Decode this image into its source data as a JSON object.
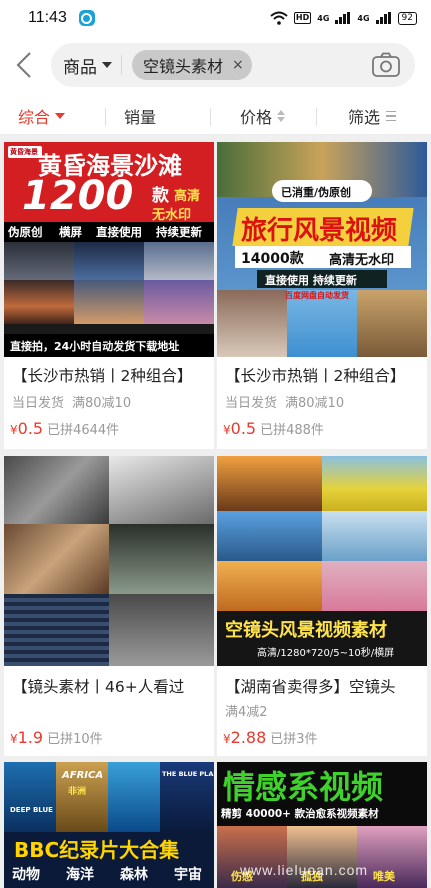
{
  "status": {
    "time": "11:43",
    "battery": "92",
    "hd": "HD",
    "net1": "4G",
    "net2": "4G"
  },
  "search": {
    "category": "商品",
    "chip": "空镜头素材",
    "chip_close": "×"
  },
  "sort": {
    "tabs": [
      "综合",
      "销量",
      "价格",
      "筛选"
    ]
  },
  "colors": {
    "accent": "#e83a2e",
    "muted": "#999999"
  },
  "cards": [
    {
      "title": "【长沙市热销丨2种组合】",
      "tags": [
        "当日发货",
        "满80减10"
      ],
      "currency": "¥",
      "price": "0.5",
      "sold": "已拼4644件",
      "poster": {
        "brand": "黄昏海景",
        "headline": "黄昏海景沙滩",
        "count": "1200",
        "unit": "款",
        "quality": "高清",
        "nowm": "无水印",
        "features": [
          "伪原创",
          "横屏",
          "直接使用",
          "持续更新"
        ],
        "footer": "直接拍，24小时自动发货下载地址"
      }
    },
    {
      "title": "【长沙市热销丨2种组合】",
      "tags": [
        "当日发货",
        "满80减10"
      ],
      "currency": "¥",
      "price": "0.5",
      "sold": "已拼488件",
      "poster": {
        "badge": "已消重/伪原创",
        "headline": "旅行风景视频",
        "count": "14000款",
        "quality": "高清无水印",
        "features": "直接使用  持续更新",
        "note": "百度网盘自动发货"
      }
    },
    {
      "title": "【镜头素材丨46+人看过",
      "tags": [],
      "currency": "¥",
      "price": "1.9",
      "sold": "已拼10件",
      "poster": {}
    },
    {
      "title": "【湖南省卖得多】空镜头",
      "tags": [
        "满4减2"
      ],
      "currency": "¥",
      "price": "2.88",
      "sold": "已拼3件",
      "poster": {
        "headline": "空镜头风景视频素材",
        "spec": "高清/1280*720/5~10秒/横屏"
      }
    },
    {
      "title": "",
      "tags": [],
      "poster": {
        "labels": [
          "AFRICA",
          "非洲",
          "DEEP BLUE",
          "THE BLUE PLANET"
        ],
        "headline": "BBC纪录片大合集",
        "cats": [
          "动物",
          "海洋",
          "森林",
          "宇宙"
        ]
      }
    },
    {
      "title": "",
      "tags": [],
      "poster": {
        "headline": "情感系视频",
        "sub": "精剪 40000+ 款治愈系视频素材",
        "cats": [
          "伤感",
          "孤独",
          "唯美"
        ]
      }
    }
  ],
  "watermark": "www.lieluoan.com"
}
